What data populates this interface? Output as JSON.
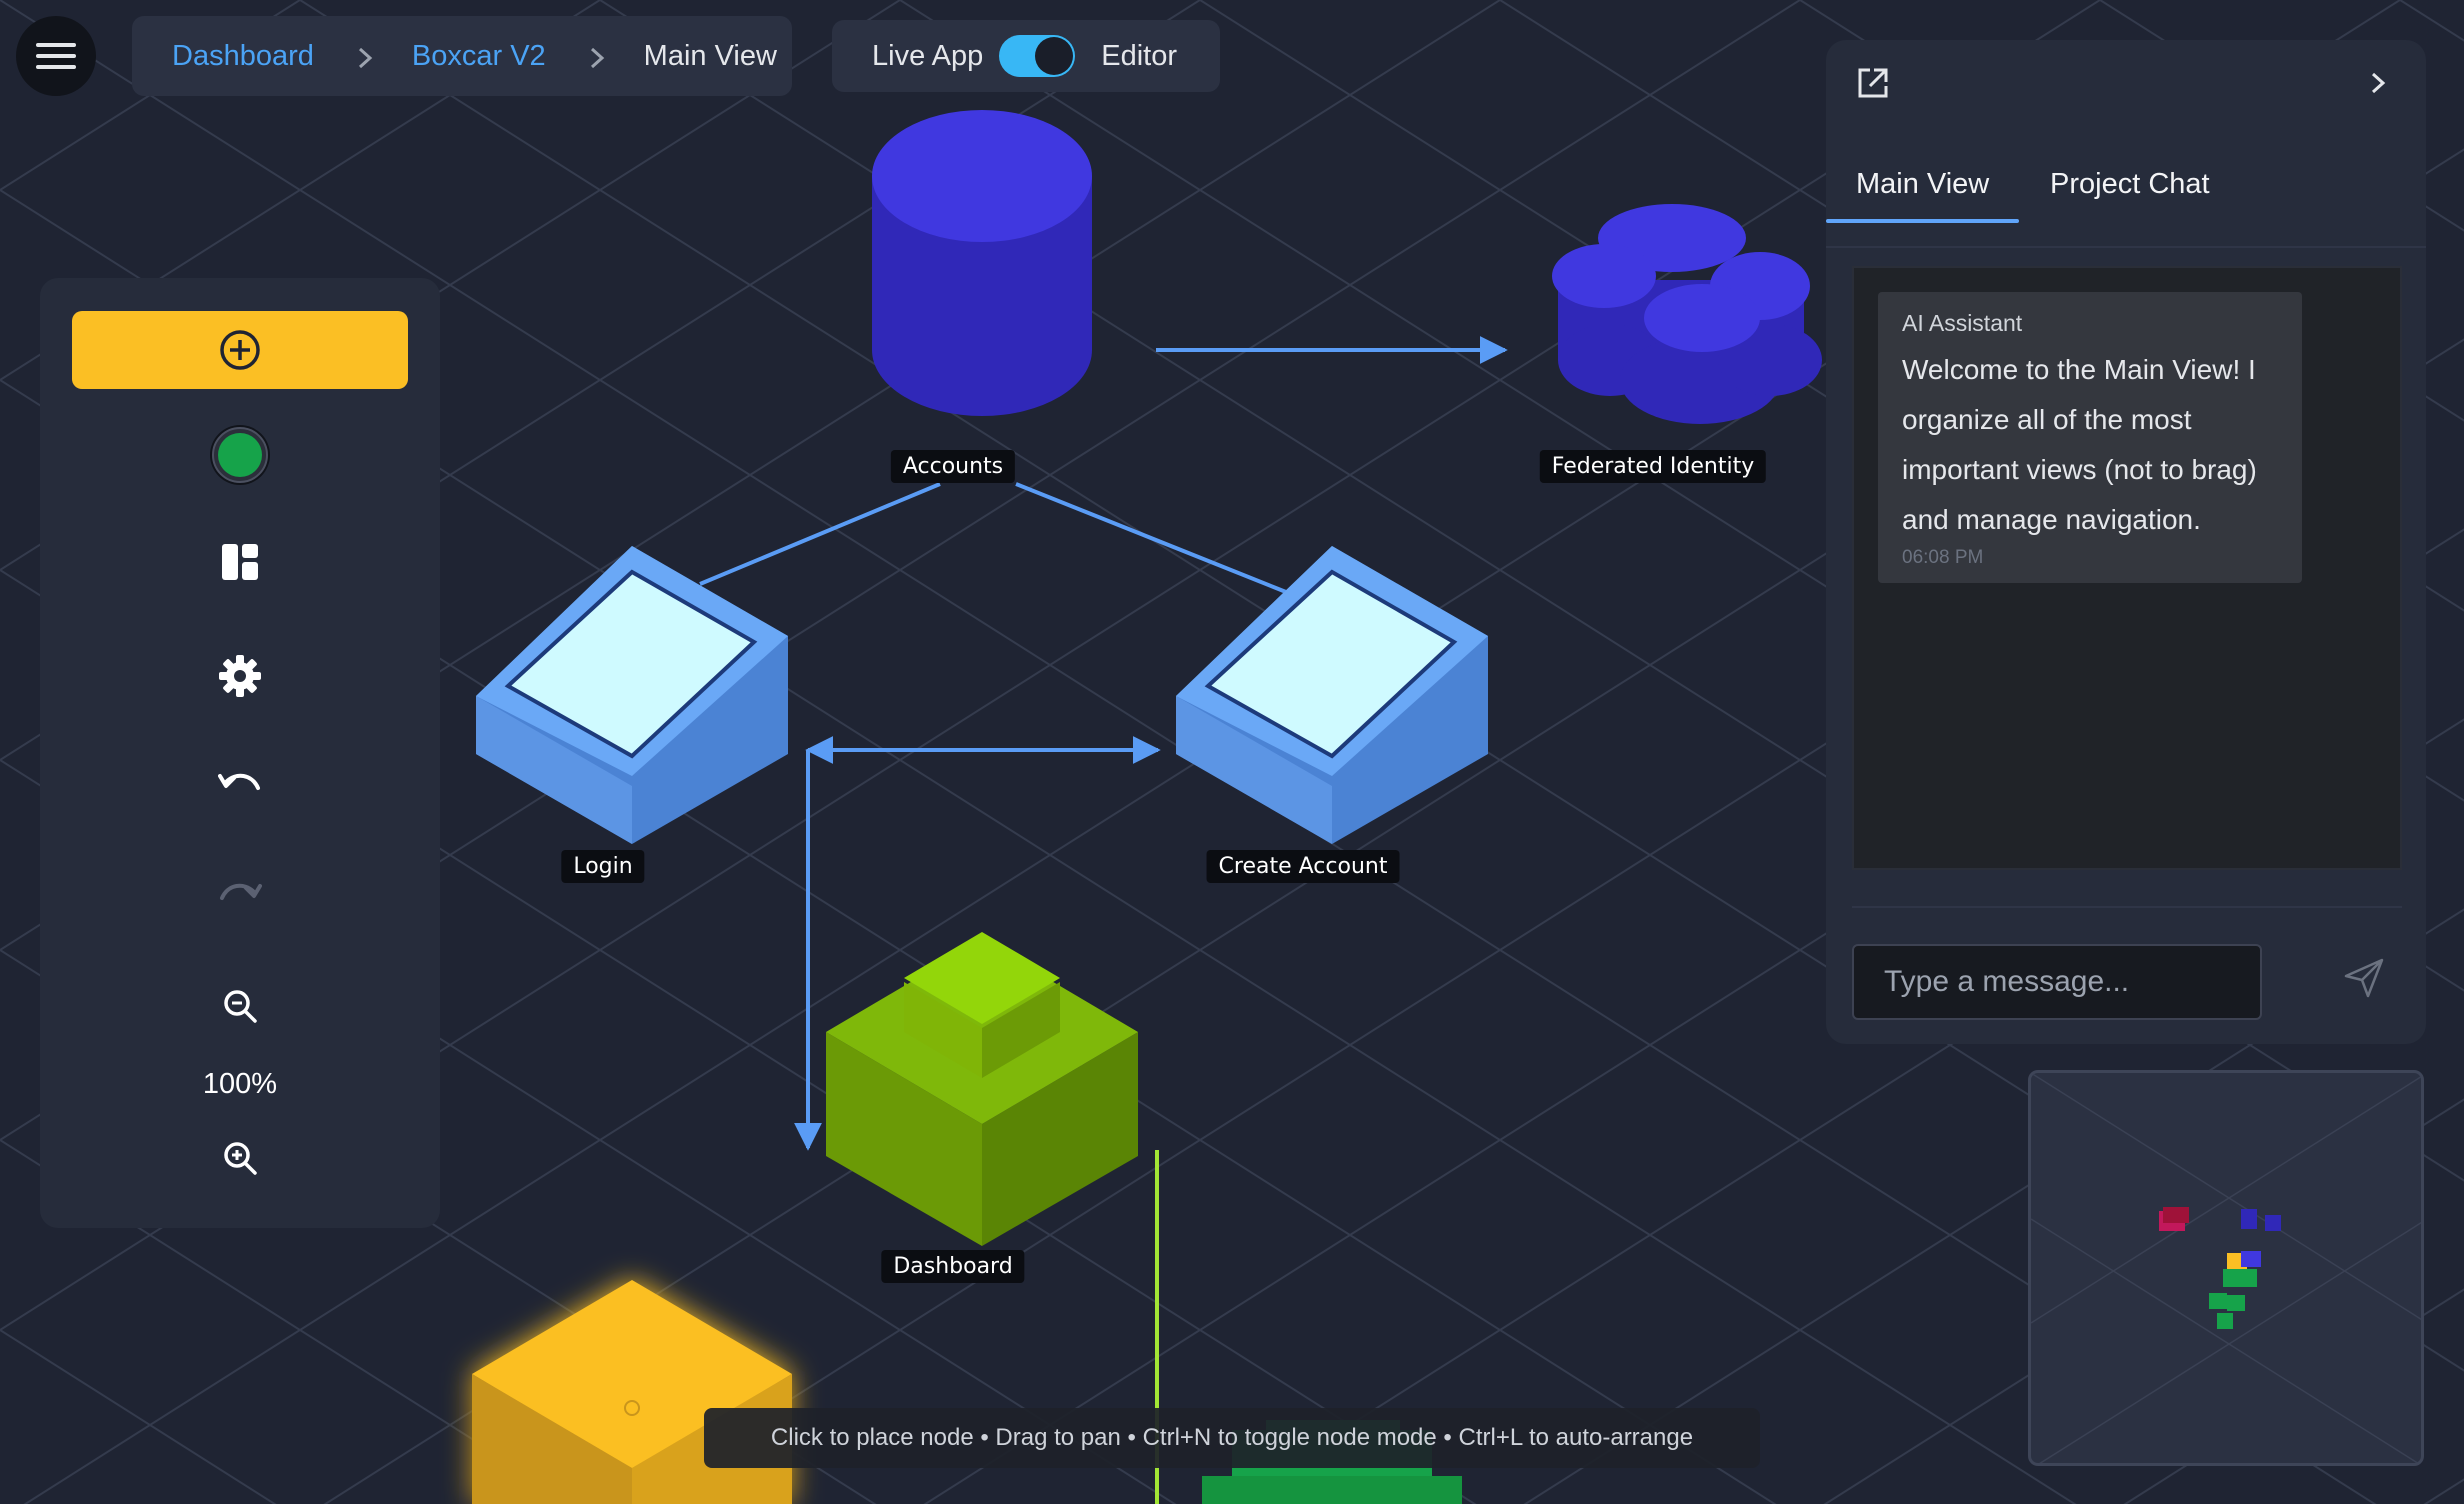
{
  "breadcrumb": {
    "items": [
      "Dashboard",
      "Boxcar V2"
    ],
    "current": "Main View"
  },
  "mode_toggle": {
    "left_label": "Live App",
    "right_label": "Editor",
    "state": "editor"
  },
  "toolbar": {
    "zoom_level": "100%",
    "icons": [
      "add-circle-icon",
      "status-dot-icon",
      "layout-icon",
      "gear-icon",
      "undo-icon",
      "redo-icon",
      "zoom-out-icon",
      "zoom-in-icon"
    ],
    "add_color": "#fbbf24",
    "status_color": "#16a34a"
  },
  "diagram": {
    "nodes": [
      {
        "id": "accounts",
        "label": "Accounts",
        "shape": "database",
        "color": "#3b35d9"
      },
      {
        "id": "federated",
        "label": "Federated Identity",
        "shape": "cloud",
        "color": "#3b35d9"
      },
      {
        "id": "login",
        "label": "Login",
        "shape": "screen",
        "color": "#5b9ff0"
      },
      {
        "id": "create",
        "label": "Create Account",
        "shape": "screen",
        "color": "#5b9ff0"
      },
      {
        "id": "dashboard",
        "label": "Dashboard",
        "shape": "cube-stack",
        "color": "#6b9a06"
      },
      {
        "id": "yellow-node",
        "label": "",
        "shape": "cube",
        "color": "#fbbf24"
      },
      {
        "id": "green-node",
        "label": "",
        "shape": "block",
        "color": "#16a34a"
      }
    ],
    "edge_color": "#5a9cf5"
  },
  "panel": {
    "tabs": [
      "Main View",
      "Project Chat"
    ],
    "active_tab": "Main View",
    "messages": [
      {
        "sender": "AI Assistant",
        "text": "Welcome to the Main View! I organize all of the most important views (not to brag) and manage navigation.",
        "time": "06:08 PM"
      }
    ],
    "input_placeholder": "Type a message..."
  },
  "hint": "Click to place node • Drag to pan • Ctrl+N to toggle node mode • Ctrl+L to auto-arrange"
}
